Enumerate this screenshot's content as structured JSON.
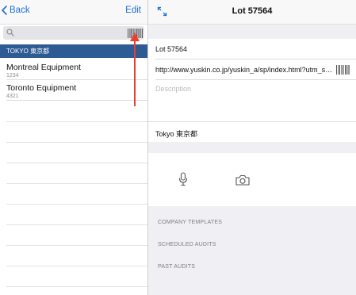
{
  "master": {
    "back_label": "Back",
    "edit_label": "Edit",
    "search": {
      "placeholder": ""
    },
    "group_header": "TOKYO 東京都",
    "items": [
      {
        "name": "Montreal Equipment",
        "code": "1234"
      },
      {
        "name": "Toronto Equipment",
        "code": "4321"
      }
    ]
  },
  "detail": {
    "title": "Lot 57564",
    "name_value": "Lot 57564",
    "url_value": "http://www.yuskin.co.jp/yuskin_a/sp/index.html?utm_source",
    "description_placeholder": "Description",
    "location_value": "Tokyo 東京都",
    "sections": [
      "COMPANY TEMPLATES",
      "SCHEDULED AUDITS",
      "PAST AUDITS"
    ]
  },
  "colors": {
    "accent": "#1f6fd6",
    "header_bg": "#2e5b94",
    "annotation_arrow": "#e8402a",
    "grouped_bg": "#efeff4"
  },
  "icons": [
    "chevron-left-icon",
    "search-icon",
    "barcode-icon",
    "expand-icon",
    "microphone-icon",
    "camera-icon"
  ]
}
